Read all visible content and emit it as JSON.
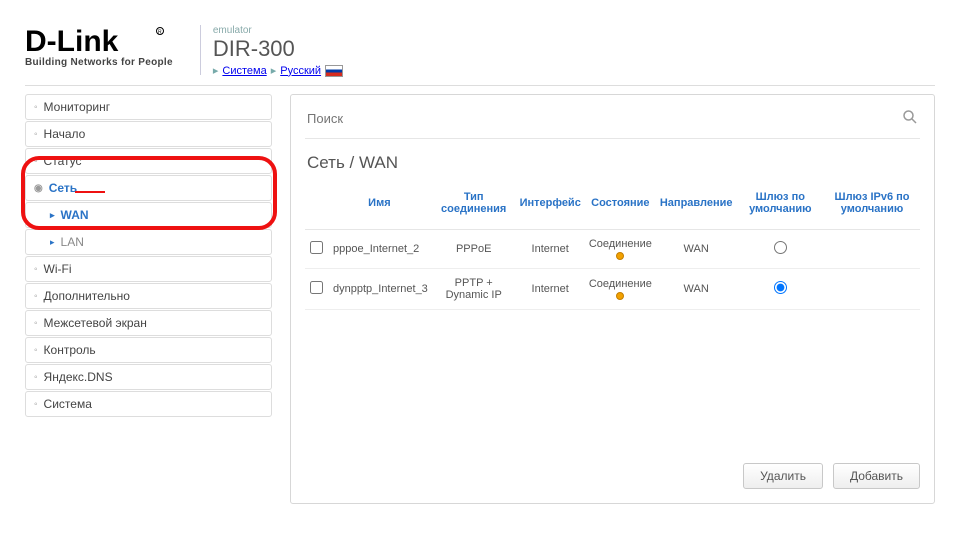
{
  "header": {
    "brand_tagline": "Building Networks for People",
    "emu_label": "emulator",
    "model": "DIR-300",
    "crumbs": {
      "system": "Система",
      "language": "Русский"
    }
  },
  "sidebar": {
    "items": [
      {
        "label": "Мониторинг"
      },
      {
        "label": "Начало"
      },
      {
        "label": "Статус"
      },
      {
        "label": "Сеть",
        "expanded": true,
        "children": [
          {
            "label": "WAN",
            "active": true
          },
          {
            "label": "LAN",
            "active": false
          }
        ]
      },
      {
        "label": "Wi-Fi"
      },
      {
        "label": "Дополнительно"
      },
      {
        "label": "Межсетевой экран"
      },
      {
        "label": "Контроль"
      },
      {
        "label": "Яндекс.DNS"
      },
      {
        "label": "Система"
      }
    ]
  },
  "content": {
    "search_placeholder": "Поиск",
    "title": "Сеть  /   WAN",
    "columns": {
      "name": "Имя",
      "type": "Тип соединения",
      "iface": "Интерфейс",
      "state": "Состояние",
      "direction": "Направление",
      "gw": "Шлюз по умолчанию",
      "gw6": "Шлюз IPv6 по умолчанию"
    },
    "rows": [
      {
        "name": "pppoe_Internet_2",
        "type": "PPPoE",
        "iface": "Internet",
        "state": "Соединение",
        "direction": "WAN",
        "gw_default": false
      },
      {
        "name": "dynpptp_Internet_3",
        "type": "PPTP + Dynamic IP",
        "iface": "Internet",
        "state": "Соединение",
        "direction": "WAN",
        "gw_default": true
      }
    ],
    "buttons": {
      "delete": "Удалить",
      "add": "Добавить"
    }
  }
}
